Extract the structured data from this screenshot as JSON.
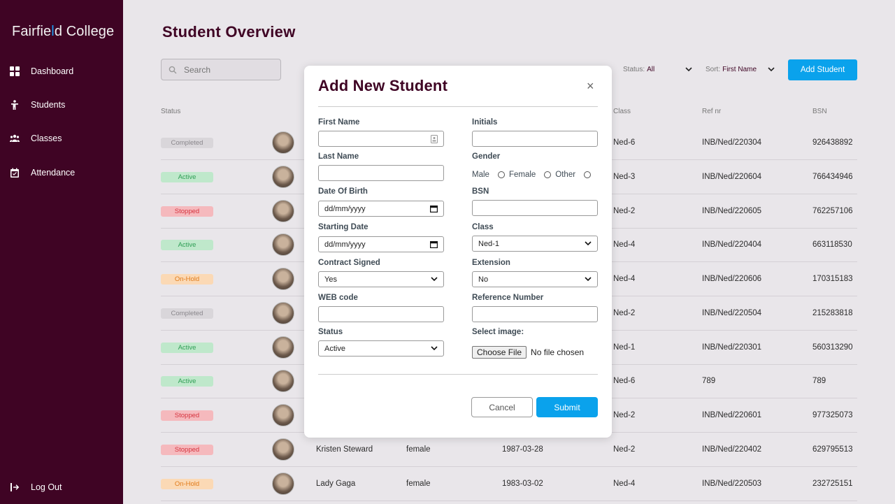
{
  "app": {
    "logo_prefix": "Fairfie",
    "logo_accent": "l",
    "logo_mid": "d",
    "logo_suffix": " College"
  },
  "sidebar": {
    "items": [
      {
        "label": "Dashboard",
        "icon": "grid-icon"
      },
      {
        "label": "Students",
        "icon": "person-icon"
      },
      {
        "label": "Classes",
        "icon": "group-icon"
      },
      {
        "label": "Attendance",
        "icon": "calendar-icon"
      }
    ],
    "logout": "Log Out"
  },
  "page": {
    "title": "Student Overview"
  },
  "toolbar": {
    "search_placeholder": "Search",
    "status_label": "Status:",
    "status_value": "All",
    "sort_label": "Sort:",
    "sort_value": "First Name",
    "add_label": "Add Student"
  },
  "table": {
    "headers": {
      "status": "Status",
      "class": "Class",
      "ref": "Ref nr",
      "bsn": "BSN"
    },
    "rows": [
      {
        "status": "Completed",
        "name": "",
        "gender": "",
        "dob": "",
        "class": "Ned-6",
        "ref": "INB/Ned/220304",
        "bsn": "926438892"
      },
      {
        "status": "Active",
        "name": "",
        "gender": "",
        "dob": "",
        "class": "Ned-3",
        "ref": "INB/Ned/220604",
        "bsn": "766434946"
      },
      {
        "status": "Stopped",
        "name": "",
        "gender": "",
        "dob": "",
        "class": "Ned-2",
        "ref": "INB/Ned/220605",
        "bsn": "762257106"
      },
      {
        "status": "Active",
        "name": "",
        "gender": "",
        "dob": "",
        "class": "Ned-4",
        "ref": "INB/Ned/220404",
        "bsn": "663118530"
      },
      {
        "status": "On-Hold",
        "name": "",
        "gender": "",
        "dob": "",
        "class": "Ned-4",
        "ref": "INB/Ned/220606",
        "bsn": "170315183"
      },
      {
        "status": "Completed",
        "name": "",
        "gender": "",
        "dob": "",
        "class": "Ned-2",
        "ref": "INB/Ned/220504",
        "bsn": "215283818"
      },
      {
        "status": "Active",
        "name": "",
        "gender": "",
        "dob": "",
        "class": "Ned-1",
        "ref": "INB/Ned/220301",
        "bsn": "560313290"
      },
      {
        "status": "Active",
        "name": "",
        "gender": "",
        "dob": "",
        "class": "Ned-6",
        "ref": "789",
        "bsn": "789"
      },
      {
        "status": "Stopped",
        "name": "",
        "gender": "",
        "dob": "",
        "class": "Ned-2",
        "ref": "INB/Ned/220601",
        "bsn": "977325073"
      },
      {
        "status": "Stopped",
        "name": "Kristen Steward",
        "gender": "female",
        "dob": "1987-03-28",
        "class": "Ned-2",
        "ref": "INB/Ned/220402",
        "bsn": "629795513"
      },
      {
        "status": "On-Hold",
        "name": "Lady Gaga",
        "gender": "female",
        "dob": "1983-03-02",
        "class": "Ned-4",
        "ref": "INB/Ned/220503",
        "bsn": "232725151"
      }
    ]
  },
  "status_colors": {
    "Completed": {
      "bg": "#d9d6da",
      "fg": "#8a878c"
    },
    "Active": {
      "bg": "#bfe8cb",
      "fg": "#2f9e55"
    },
    "Stopped": {
      "bg": "#f5b9bd",
      "fg": "#d6343f"
    },
    "On-Hold": {
      "bg": "#fbd9b5",
      "fg": "#e07b1a"
    }
  },
  "modal": {
    "title": "Add New Student",
    "close": "×",
    "first_name_label": "First Name",
    "initials_label": "Initials",
    "last_name_label": "Last Name",
    "gender_label": "Gender",
    "gender_options": [
      "Male",
      "Female",
      "Other"
    ],
    "dob_label": "Date Of Birth",
    "dob_value": "dd/mm/yyyy",
    "bsn_label": "BSN",
    "start_label": "Starting Date",
    "start_value": "dd/mm/yyyy",
    "class_label": "Class",
    "class_value": "Ned-1",
    "contract_label": "Contract Signed",
    "contract_value": "Yes",
    "extension_label": "Extension",
    "extension_value": "No",
    "web_label": "WEB code",
    "ref_label": "Reference Number",
    "status_label": "Status",
    "status_value": "Active",
    "image_label": "Select image:",
    "file_button": "Choose File",
    "file_status": "No file chosen",
    "cancel": "Cancel",
    "submit": "Submit"
  },
  "colors": {
    "sidebar": "#3f0424",
    "accent": "#0aa2ec",
    "title": "#3f0424"
  }
}
